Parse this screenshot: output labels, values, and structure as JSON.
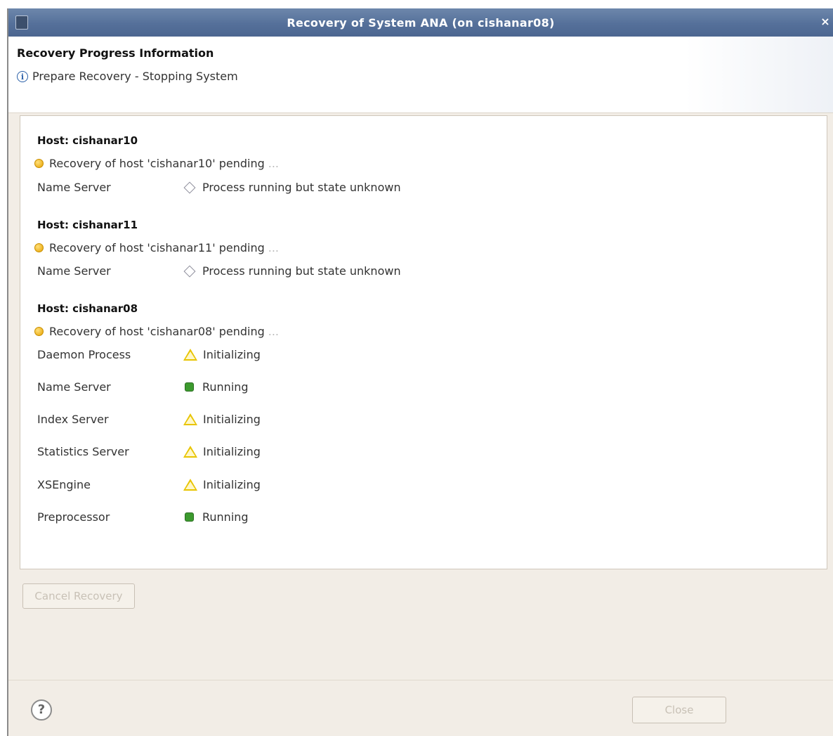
{
  "window": {
    "title": "Recovery of System ANA  (on cishanar08)",
    "close_glyph": "×"
  },
  "header": {
    "heading": "Recovery Progress Information",
    "info_icon": "info-icon",
    "step_text": "Prepare Recovery - Stopping System"
  },
  "hosts": [
    {
      "title": "Host: cishanar10",
      "pending": "Recovery of host 'cishanar10' pending",
      "services": [
        {
          "label": "Name Server",
          "icon": "diamond-icon",
          "status": "Process running but state unknown"
        }
      ]
    },
    {
      "title": "Host: cishanar11",
      "pending": "Recovery of host 'cishanar11' pending",
      "services": [
        {
          "label": "Name Server",
          "icon": "diamond-icon",
          "status": "Process running but state unknown"
        }
      ]
    },
    {
      "title": "Host: cishanar08",
      "pending": "Recovery of host 'cishanar08' pending",
      "services": [
        {
          "label": "Daemon Process",
          "icon": "warning-icon",
          "status": "Initializing"
        },
        {
          "label": "Name Server",
          "icon": "running-icon",
          "status": "Running"
        },
        {
          "label": "Index Server",
          "icon": "warning-icon",
          "status": "Initializing"
        },
        {
          "label": "Statistics Server",
          "icon": "warning-icon",
          "status": "Initializing"
        },
        {
          "label": "XSEngine",
          "icon": "warning-icon",
          "status": "Initializing"
        },
        {
          "label": "Preprocessor",
          "icon": "running-icon",
          "status": "Running"
        }
      ]
    }
  ],
  "ellipsis": "...",
  "buttons": {
    "cancel_label": "Cancel Recovery",
    "close_label": "Close",
    "help_glyph": "?"
  },
  "colors": {
    "title_bar": "#55709a",
    "running": "#3c9a2e",
    "warning": "#e8c400",
    "pending": "#e6a100"
  }
}
